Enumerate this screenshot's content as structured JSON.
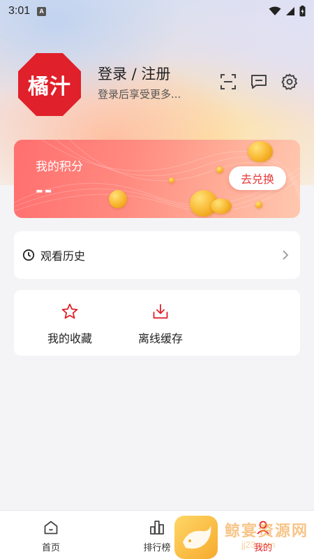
{
  "status_bar": {
    "time": "3:01",
    "notif_badge": "A"
  },
  "profile": {
    "logo_text": "橘汁",
    "login_label": "登录 / 注册",
    "login_sub": "登录后享受更多...",
    "icons": [
      "scan-icon",
      "message-icon",
      "gear-icon"
    ]
  },
  "points": {
    "label": "我的积分",
    "value": "--",
    "redeem_label": "去兑换"
  },
  "history": {
    "label": "观看历史"
  },
  "actions": [
    {
      "label": "我的收藏",
      "icon": "star-icon"
    },
    {
      "label": "离线缓存",
      "icon": "download-icon"
    }
  ],
  "bottom_nav": [
    {
      "label": "首页",
      "icon": "home-icon"
    },
    {
      "label": "排行榜",
      "icon": "chart-icon"
    },
    {
      "label": "我的",
      "icon": "profile-icon"
    }
  ],
  "watermark": {
    "text": "鲸宴资源网",
    "sub": "jj23.com"
  },
  "colors": {
    "accent": "#e0202a",
    "card_red": "#ff7a70",
    "coin": "#f7b52c"
  }
}
